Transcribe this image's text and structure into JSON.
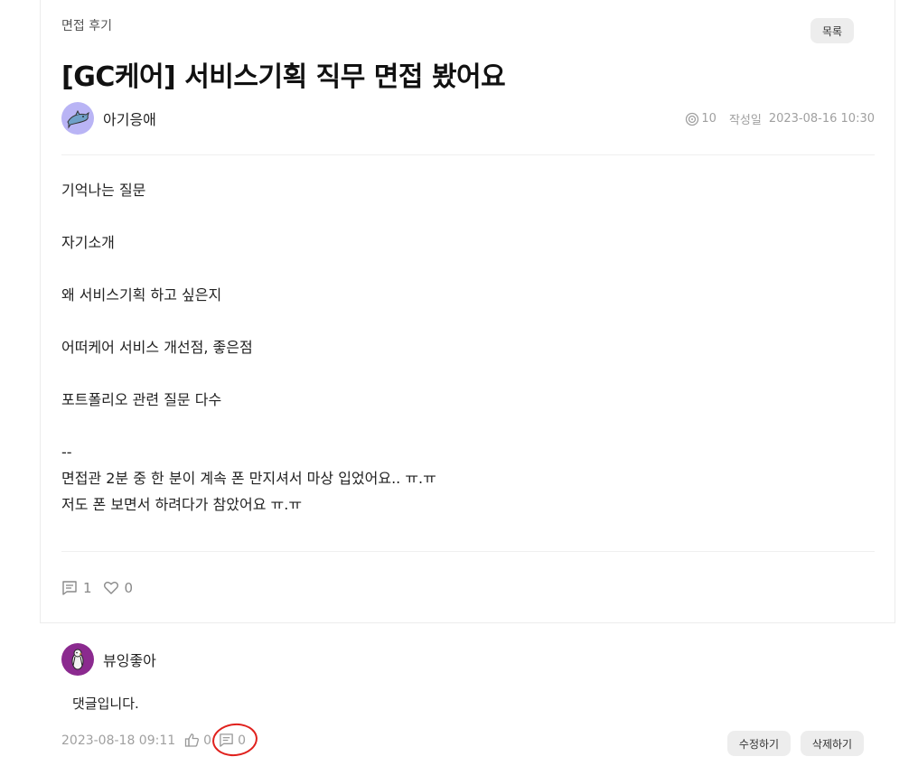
{
  "post": {
    "category": "면접 후기",
    "list_button": "목록",
    "title": "[GC케어] 서비스기획 직무 면접 봤어요",
    "author": {
      "name": "아기응애",
      "avatar_icon": "dolphin-icon"
    },
    "views": "10",
    "date_label": "작성일",
    "date": "2023-08-16 10:30",
    "body": [
      "기억나는 질문",
      "",
      "자기소개",
      "",
      "왜 서비스기획 하고 싶은지",
      "",
      "어떠케어 서비스 개선점, 좋은점",
      "",
      "포트폴리오 관련 질문 다수",
      "",
      "--",
      "면접관 2분 중 한 분이 계속 폰 만지셔서 마상 입었어요.. ㅠ.ㅠ",
      "저도 폰 보면서 하려다가 참았어요 ㅠ.ㅠ"
    ],
    "comment_count": "1",
    "like_count": "0"
  },
  "comment": {
    "author": {
      "name": "뷰잉좋아",
      "avatar_icon": "penguin-icon"
    },
    "text": "댓글입니다.",
    "date": "2023-08-18 09:11",
    "like_count": "0",
    "reply_count": "0",
    "edit_button": "수정하기",
    "delete_button": "삭제하기",
    "highlight_color": "#e0211d"
  }
}
